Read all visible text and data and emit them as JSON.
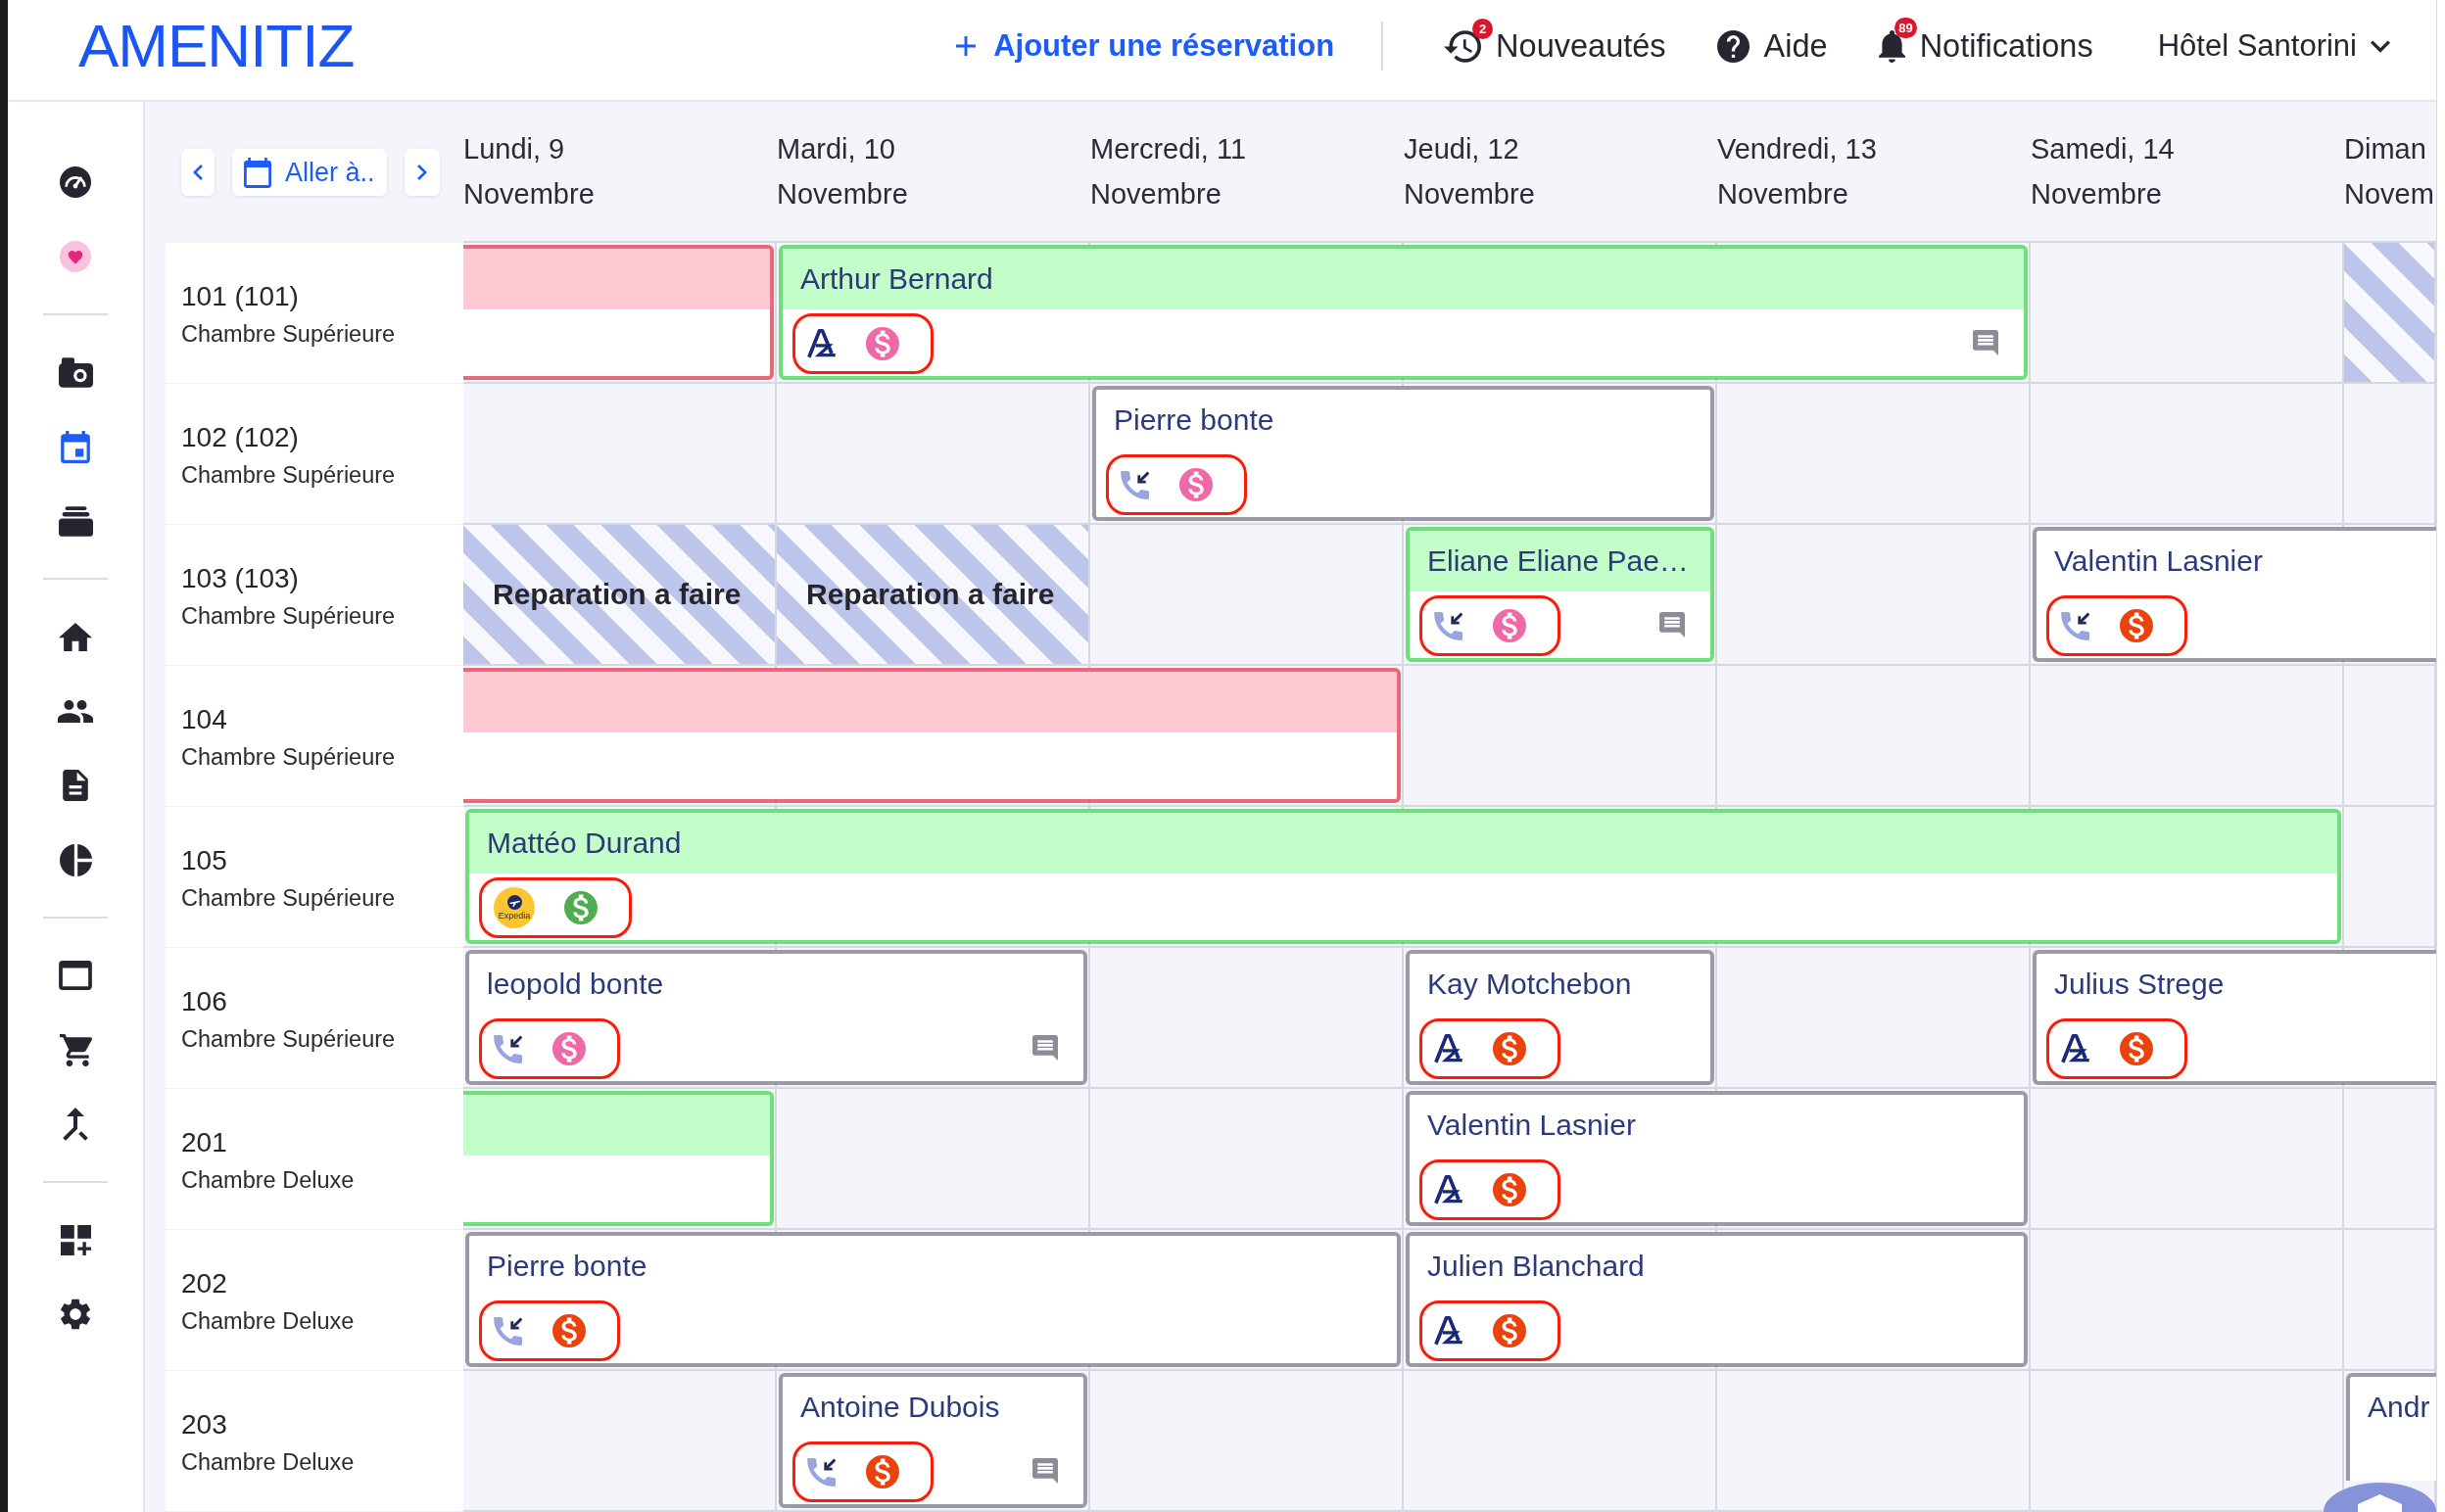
{
  "topbar": {
    "logo": "AMENITIZ",
    "add_button": "Ajouter une réservation",
    "links": [
      {
        "label": "Nouveautés",
        "badge": "2"
      },
      {
        "label": "Aide"
      },
      {
        "label": "Notifications",
        "badge": "89"
      }
    ],
    "hotel_menu": "Hôtel Santorini"
  },
  "sidebar": {
    "groups": [
      {
        "items": [
          {
            "selected": false
          },
          {
            "selected": false
          }
        ]
      },
      {
        "items": [
          {
            "selected": false
          },
          {
            "selected": true
          },
          {
            "selected": false
          }
        ]
      },
      {
        "items": [
          {
            "selected": false
          },
          {
            "selected": false
          },
          {
            "selected": false
          },
          {
            "selected": false
          }
        ]
      },
      {
        "items": [
          {
            "selected": false
          },
          {
            "selected": false
          },
          {
            "selected": false
          }
        ]
      },
      {
        "items": [
          {
            "selected": false
          },
          {
            "selected": false
          }
        ]
      }
    ]
  },
  "calendar": {
    "goto_label": "Aller à..",
    "days": [
      {
        "weekday": "Lundi, 9",
        "month": "Novembre"
      },
      {
        "weekday": "Mardi, 10",
        "month": "Novembre"
      },
      {
        "weekday": "Mercredi, 11",
        "month": "Novembre"
      },
      {
        "weekday": "Jeudi, 12",
        "month": "Novembre"
      },
      {
        "weekday": "Vendredi, 13",
        "month": "Novembre"
      },
      {
        "weekday": "Samedi, 14",
        "month": "Novembre"
      },
      {
        "weekday": "Diman",
        "month": "Novem"
      }
    ],
    "rooms": [
      {
        "name": "101 (101)",
        "type": "Chambre Supérieure",
        "cells": [
          {
            "kind": "booking",
            "color": "#e8687c",
            "header": {
              "color": "#ffc9d3"
            },
            "starts_before": true,
            "comment": false
          },
          {
            "kind": "booking",
            "guest": "Arthur Bernard",
            "color": "#6ee07a",
            "header": {
              "color": "#c3fdc9"
            },
            "starts_before": false,
            "source": {
              "kind": "amenitiz"
            },
            "payment": {
              "color": "#ef68a7"
            },
            "comment": true
          },
          {
            "kind": "continued"
          },
          {
            "kind": "continued"
          },
          {
            "kind": "continued"
          },
          {
            "kind": "empty"
          },
          {
            "kind": "blocked"
          }
        ]
      },
      {
        "name": "102 (102)",
        "type": "Chambre Supérieure",
        "cells": [
          {
            "kind": "empty"
          },
          {
            "kind": "empty"
          },
          {
            "kind": "booking",
            "guest": "Pierre bonte",
            "color": "#9b9ba7",
            "starts_before": false,
            "source": {
              "kind": "phone"
            },
            "payment": {
              "color": "#ef68a7"
            },
            "comment": false
          },
          {
            "kind": "continued"
          },
          {
            "kind": "empty"
          },
          {
            "kind": "empty"
          },
          {
            "kind": "empty"
          }
        ]
      },
      {
        "name": "103 (103)",
        "type": "Chambre Supérieure",
        "cells": [
          {
            "kind": "blocked",
            "label": "Reparation a faire"
          },
          {
            "kind": "blocked",
            "label": "Reparation a faire"
          },
          {
            "kind": "empty"
          },
          {
            "kind": "booking",
            "guest": "Eliane Eliane Pae…",
            "color": "#6ee07a",
            "header": {
              "color": "#c3fdc9"
            },
            "starts_before": false,
            "source": {
              "kind": "phone"
            },
            "payment": {
              "color": "#ef68a7"
            },
            "comment": true
          },
          {
            "kind": "empty"
          },
          {
            "kind": "booking",
            "guest": "Valentin Lasnier",
            "color": "#9b9ba7",
            "starts_before": false,
            "source": {
              "kind": "phone"
            },
            "payment": {
              "color": "#e8430f"
            },
            "comment": false
          },
          {
            "kind": "continued"
          }
        ]
      },
      {
        "name": "104",
        "type": "Chambre Supérieure",
        "cells": [
          {
            "kind": "booking",
            "color": "#e8687c",
            "header": {
              "color": "#ffc9d3"
            },
            "starts_before": true,
            "comment": false
          },
          {
            "kind": "continued"
          },
          {
            "kind": "continued"
          },
          {
            "kind": "empty"
          },
          {
            "kind": "empty"
          },
          {
            "kind": "empty"
          },
          {
            "kind": "empty"
          }
        ]
      },
      {
        "name": "105",
        "type": "Chambre Supérieure",
        "cells": [
          {
            "kind": "booking",
            "guest": "Mattéo Durand",
            "color": "#6ee07a",
            "header": {
              "color": "#c3fdc9"
            },
            "starts_before": false,
            "source": {
              "kind": "expedia",
              "label": "Expedia"
            },
            "payment": {
              "color": "#4cae50"
            },
            "comment": false
          },
          {
            "kind": "continued"
          },
          {
            "kind": "continued"
          },
          {
            "kind": "continued"
          },
          {
            "kind": "continued"
          },
          {
            "kind": "continued"
          },
          {
            "kind": "empty"
          }
        ]
      },
      {
        "name": "106",
        "type": "Chambre Supérieure",
        "cells": [
          {
            "kind": "booking",
            "guest": "leopold bonte",
            "color": "#9b9ba7",
            "starts_before": false,
            "source": {
              "kind": "phone"
            },
            "payment": {
              "color": "#ef68a7"
            },
            "comment": true
          },
          {
            "kind": "continued"
          },
          {
            "kind": "empty"
          },
          {
            "kind": "booking",
            "guest": "Kay Motchebon",
            "color": "#9b9ba7",
            "starts_before": false,
            "source": {
              "kind": "amenitiz"
            },
            "payment": {
              "color": "#e8430f"
            },
            "comment": false
          },
          {
            "kind": "empty"
          },
          {
            "kind": "booking",
            "guest": "Julius Strege",
            "color": "#9b9ba7",
            "starts_before": false,
            "source": {
              "kind": "amenitiz"
            },
            "payment": {
              "color": "#e8430f"
            },
            "comment": false
          },
          {
            "kind": "continued"
          }
        ]
      },
      {
        "name": "201",
        "type": "Chambre Deluxe",
        "cells": [
          {
            "kind": "booking",
            "color": "#6ee07a",
            "header": {
              "color": "#c3fdc9"
            },
            "starts_before": true,
            "comment": false
          },
          {
            "kind": "empty"
          },
          {
            "kind": "empty"
          },
          {
            "kind": "booking",
            "guest": "Valentin Lasnier",
            "color": "#9b9ba7",
            "starts_before": false,
            "source": {
              "kind": "amenitiz"
            },
            "payment": {
              "color": "#e8430f"
            },
            "comment": false
          },
          {
            "kind": "continued"
          },
          {
            "kind": "empty"
          },
          {
            "kind": "empty"
          }
        ]
      },
      {
        "name": "202",
        "type": "Chambre Deluxe",
        "cells": [
          {
            "kind": "booking",
            "guest": "Pierre bonte",
            "color": "#9b9ba7",
            "starts_before": false,
            "source": {
              "kind": "phone"
            },
            "payment": {
              "color": "#e8430f"
            },
            "comment": false
          },
          {
            "kind": "continued"
          },
          {
            "kind": "continued"
          },
          {
            "kind": "booking",
            "guest": "Julien Blanchard",
            "color": "#9b9ba7",
            "starts_before": false,
            "source": {
              "kind": "amenitiz"
            },
            "payment": {
              "color": "#e8430f"
            },
            "comment": false
          },
          {
            "kind": "continued"
          },
          {
            "kind": "empty"
          },
          {
            "kind": "empty"
          }
        ]
      },
      {
        "name": "203",
        "type": "Chambre Deluxe",
        "cells": [
          {
            "kind": "empty"
          },
          {
            "kind": "booking",
            "guest": "Antoine Dubois",
            "color": "#9b9ba7",
            "starts_before": false,
            "source": {
              "kind": "phone"
            },
            "payment": {
              "color": "#e8430f"
            },
            "comment": true
          },
          {
            "kind": "empty"
          },
          {
            "kind": "empty"
          },
          {
            "kind": "empty"
          },
          {
            "kind": "empty"
          },
          {
            "kind": "booking",
            "guest": "Andr",
            "color": "#9b9ba7",
            "starts_before": false,
            "comment": false
          }
        ]
      }
    ]
  }
}
